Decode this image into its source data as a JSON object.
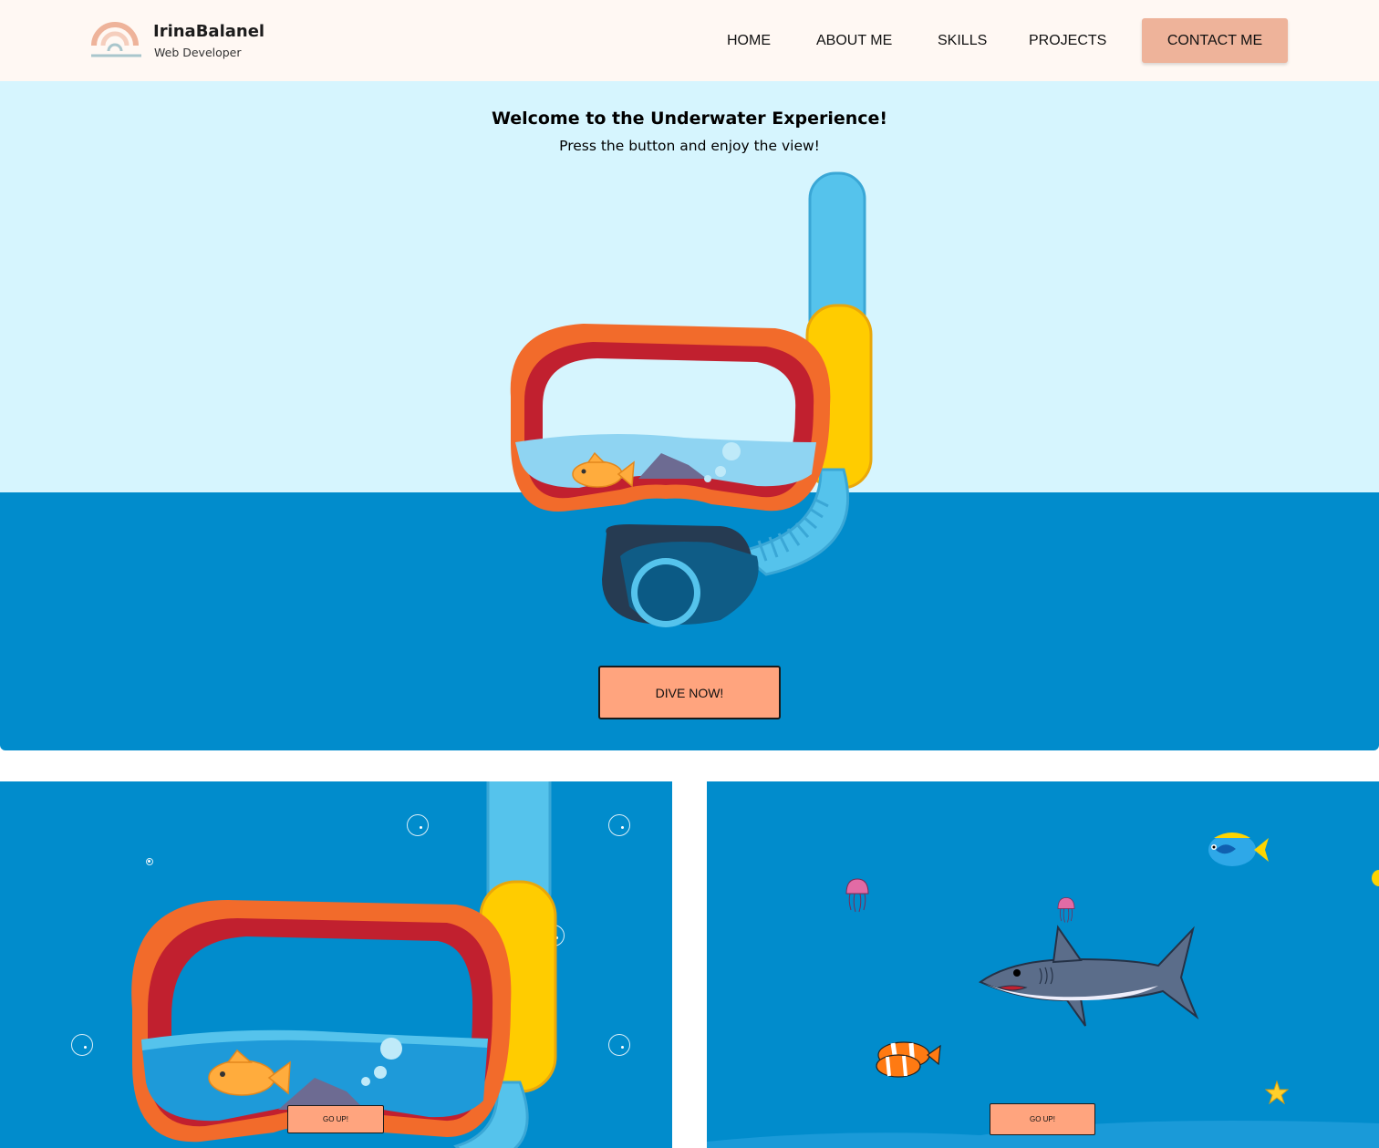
{
  "brand": {
    "name": "IrinaBalanel",
    "subtitle": "Web Developer",
    "logo_icon": "rainbow-icon"
  },
  "nav": {
    "items": [
      "HOME",
      "ABOUT ME",
      "SKILLS",
      "PROJECTS"
    ],
    "contact_label": "CONTACT ME"
  },
  "hero": {
    "title": "Welcome to the Underwater Experience!",
    "subtitle": "Press the button and enjoy the view!",
    "dive_label": "DIVE NOW!",
    "illustration": "snorkel-mask-icon"
  },
  "panels": [
    {
      "illustration": "snorkel-mask-icon",
      "button_label": "GO UP!"
    },
    {
      "illustration": "sea-life-scene",
      "button_label": "GO UP!"
    }
  ],
  "colors": {
    "header_bg": "#fff8f3",
    "sky": "#d6f5fe",
    "sea": "#018ccc",
    "accent": "#ffa47e",
    "contact": "#eeb39a"
  }
}
